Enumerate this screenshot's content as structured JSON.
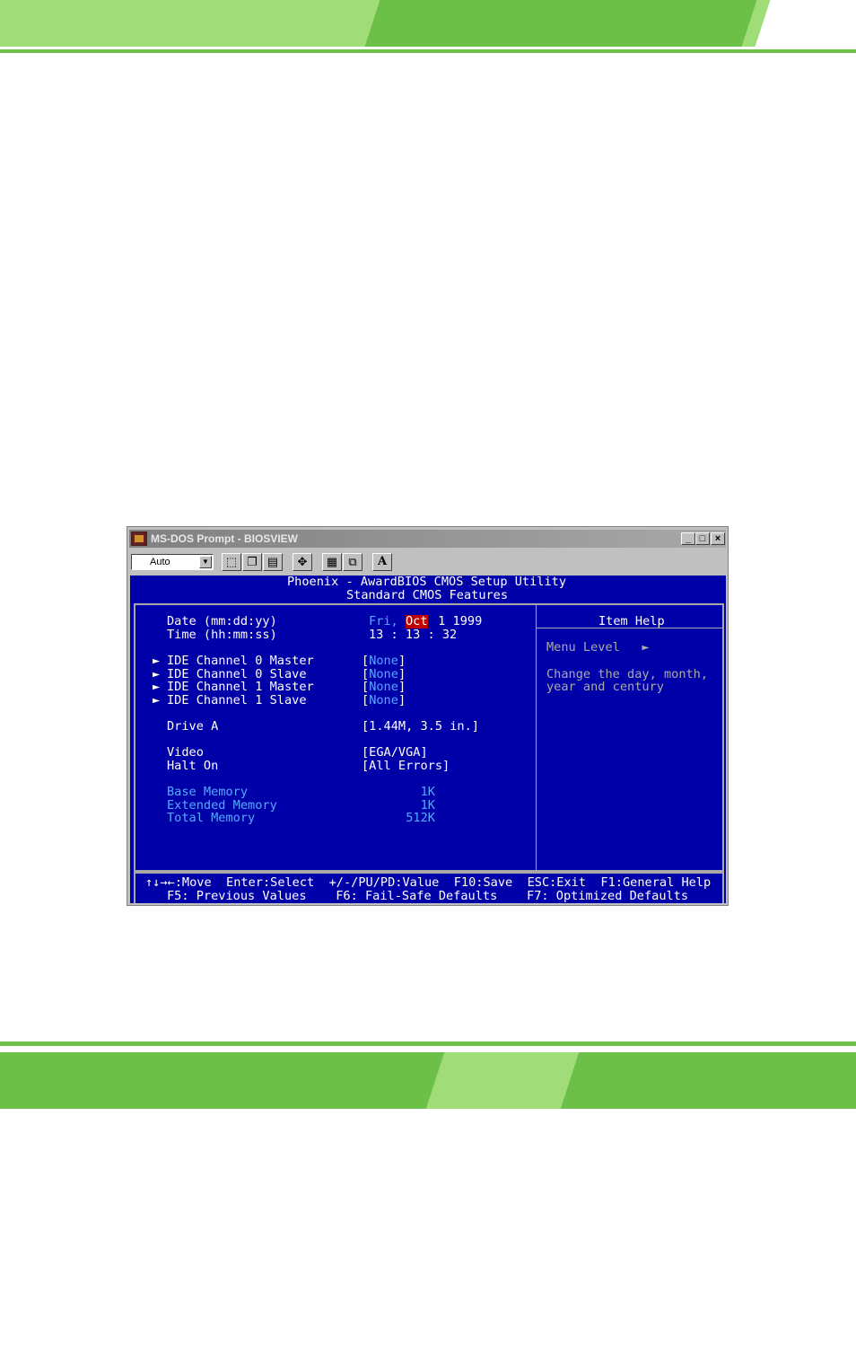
{
  "window": {
    "title": "MS-DOS Prompt - BIOSVIEW",
    "font_size_value": "Auto",
    "toolbar_font_label": "A"
  },
  "bios": {
    "header_line1": "Phoenix - AwardBIOS CMOS Setup Utility",
    "header_line2": "Standard CMOS Features",
    "date_label": "Date (mm:dd:yy)",
    "date_day": "Fri,",
    "date_month": "Oct",
    "date_rest": " 1 1999",
    "time_label": "Time (hh:mm:ss)",
    "time_value": "13 : 13 : 32",
    "ide_items": [
      {
        "label": "IDE Channel 0 Master",
        "value": "None"
      },
      {
        "label": "IDE Channel 0 Slave",
        "value": "None"
      },
      {
        "label": "IDE Channel 1 Master",
        "value": "None"
      },
      {
        "label": "IDE Channel 1 Slave",
        "value": "None"
      }
    ],
    "drive_a_label": "Drive A",
    "drive_a_value": "[1.44M, 3.5 in.]",
    "video_label": "Video",
    "video_value": "[EGA/VGA]",
    "halt_label": "Halt On",
    "halt_value": "[All Errors]",
    "memory": [
      {
        "label": "Base Memory",
        "value": "1K"
      },
      {
        "label": "Extended Memory",
        "value": "1K"
      },
      {
        "label": "Total Memory",
        "value": "512K"
      }
    ],
    "help_title": "Item Help",
    "menu_level": "Menu Level   ►",
    "help_text_1": "Change the day, month,",
    "help_text_2": "year and century",
    "footer_line1": "↑↓→←:Move  Enter:Select  +/-/PU/PD:Value  F10:Save  ESC:Exit  F1:General Help",
    "footer_line2": "F5: Previous Values    F6: Fail-Safe Defaults    F7: Optimized Defaults"
  },
  "colors": {
    "bios_bg": "#0000a8",
    "highlight": "#c00000",
    "accent_green": "#6cc048"
  }
}
